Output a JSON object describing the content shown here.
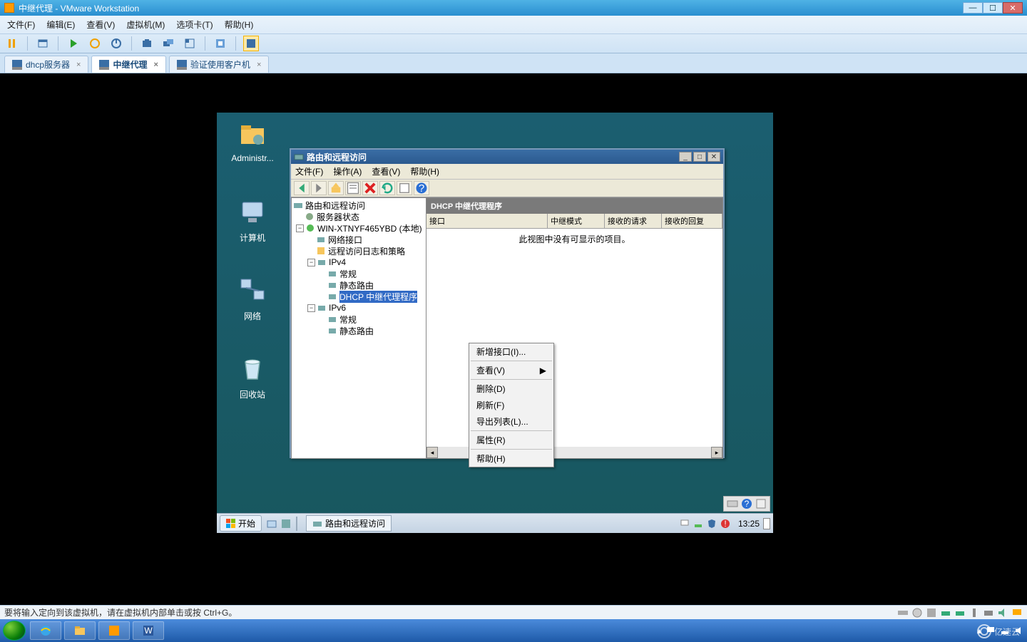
{
  "host": {
    "title": "中继代理 - VMware Workstation",
    "win_min": "—",
    "win_max": "☐",
    "win_close": "✕"
  },
  "vmw_menu": {
    "file": "文件(F)",
    "edit": "编辑(E)",
    "view": "查看(V)",
    "vm": "虚拟机(M)",
    "tabs": "选项卡(T)",
    "help": "帮助(H)"
  },
  "tabs": {
    "items": [
      {
        "label": "dhcp服务器",
        "active": false
      },
      {
        "label": "中继代理",
        "active": true
      },
      {
        "label": "验证使用客户机",
        "active": false
      }
    ],
    "close_x": "×"
  },
  "guest": {
    "desktop_icons": {
      "admin": "Administr...",
      "computer": "计算机",
      "network": "网络",
      "recycle": "回收站"
    },
    "taskbar": {
      "start": "开始",
      "app": "路由和远程访问",
      "clock": "13:25"
    }
  },
  "mmc": {
    "title": "路由和远程访问",
    "menu": {
      "file": "文件(F)",
      "action": "操作(A)",
      "view": "查看(V)",
      "help": "帮助(H)"
    },
    "tree": {
      "root": "路由和远程访问",
      "status": "服务器状态",
      "server": "WIN-XTNYF465YBD (本地)",
      "net_if": "网络接口",
      "remote_log": "远程访问日志和策略",
      "ipv4": "IPv4",
      "ipv4_general": "常规",
      "ipv4_static": "静态路由",
      "ipv4_dhcp_relay": "DHCP 中继代理程序",
      "ipv6": "IPv6",
      "ipv6_general": "常规",
      "ipv6_static": "静态路由"
    },
    "detail": {
      "heading": "DHCP 中继代理程序",
      "cols": {
        "iface": "接口",
        "mode": "中继模式",
        "recv_req": "接收的请求",
        "recv_rep": "接收的回复"
      },
      "empty": "此视图中没有可显示的项目。"
    },
    "ctx": {
      "new_if": "新增接口(I)...",
      "view": "查看(V)",
      "delete": "删除(D)",
      "refresh": "刷新(F)",
      "export": "导出列表(L)...",
      "props": "属性(R)",
      "help": "帮助(H)",
      "arrow": "▶"
    },
    "winbtns": {
      "min": "_",
      "max": "□",
      "close": "✕"
    }
  },
  "status": {
    "msg": "要将输入定向到该虚拟机，请在虚拟机内部单击或按 Ctrl+G。"
  },
  "watermark": "亿速云"
}
